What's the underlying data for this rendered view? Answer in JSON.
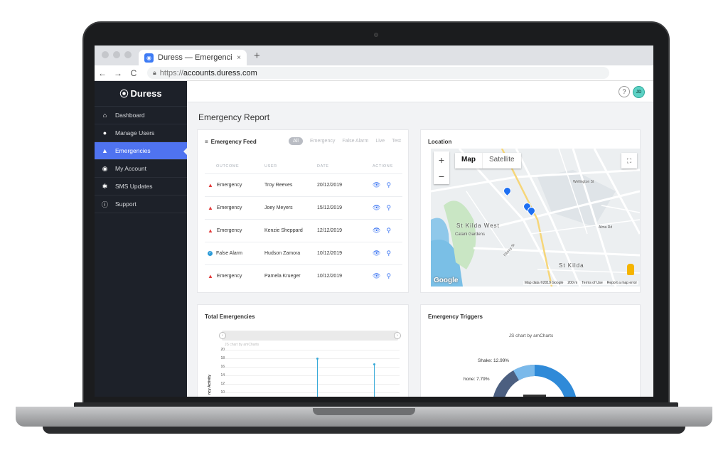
{
  "browser": {
    "tab_title": "Duress — Emergencies",
    "tab_close": "×",
    "new_tab": "+",
    "url_scheme": "https://",
    "url_host": "accounts.duress.com",
    "nav": {
      "back": "←",
      "forward": "→",
      "reload": "C"
    }
  },
  "app": {
    "logo": "Duress",
    "help": "?",
    "avatar_initials": "JD",
    "page_title": "Emergency Report"
  },
  "sidebar": {
    "items": [
      {
        "label": "Dashboard",
        "icon": "home-icon",
        "glyph": "⌂"
      },
      {
        "label": "Manage Users",
        "icon": "user-icon",
        "glyph": "●"
      },
      {
        "label": "Emergencies",
        "icon": "warning-icon",
        "glyph": "▲",
        "active": true
      },
      {
        "label": "My Account",
        "icon": "account-icon",
        "glyph": "◉"
      },
      {
        "label": "SMS Updates",
        "icon": "alarm-icon",
        "glyph": "✱"
      },
      {
        "label": "Support",
        "icon": "info-icon",
        "glyph": "ⓘ"
      }
    ]
  },
  "feed": {
    "title": "Emergency Feed",
    "filters": [
      "All",
      "Emergency",
      "False Alarm",
      "Live",
      "Test"
    ],
    "columns": [
      "OUTCOME",
      "USER",
      "DATE",
      "ACTIONS"
    ],
    "rows": [
      {
        "outcome": "Emergency",
        "type": "warning",
        "user": "Troy Reeves",
        "date": "20/12/2019"
      },
      {
        "outcome": "Emergency",
        "type": "warning",
        "user": "Joey Meyers",
        "date": "15/12/2019"
      },
      {
        "outcome": "Emergency",
        "type": "warning",
        "user": "Kenzie Sheppard",
        "date": "12/12/2019"
      },
      {
        "outcome": "False Alarm",
        "type": "ok",
        "user": "Hudson Zamora",
        "date": "10/12/2019"
      },
      {
        "outcome": "Emergency",
        "type": "warning",
        "user": "Pamela Krueger",
        "date": "10/12/2019"
      }
    ]
  },
  "location": {
    "title": "Location",
    "map_tab": "Map",
    "satellite_tab": "Satellite",
    "zoom_in": "+",
    "zoom_out": "−",
    "google": "Google",
    "map_data": "Map data ©2019 Google",
    "scale": "200 m",
    "terms": "Terms of Use",
    "report": "Report a map error",
    "labels": {
      "st_kilda_west": "St Kilda West",
      "catani": "Catani Gardens",
      "st_kilda": "St Kilda",
      "wellington": "Wellington St",
      "alma": "Alma Rd",
      "fitzroy": "Fitzroy St"
    }
  },
  "total": {
    "title": "Total Emergencies",
    "credit": "JS chart by amCharts",
    "ylabel": "ncy Activity",
    "yticks": [
      "20",
      "18",
      "16",
      "14",
      "12",
      "10"
    ]
  },
  "triggers": {
    "title": "Emergency Triggers",
    "credit": "JS chart by amCharts",
    "labels": [
      "Shake: 12.99%",
      "hone: 7.79%"
    ]
  },
  "colors": {
    "accent": "#4f73f0",
    "sidebar": "#1d2129",
    "danger": "#e23b3b",
    "chart_line": "#36a9d8"
  }
}
